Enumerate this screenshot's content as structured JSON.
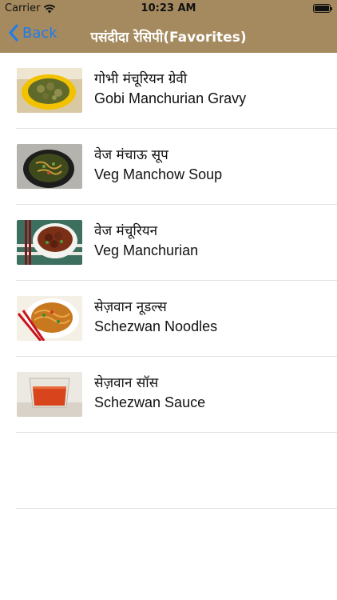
{
  "status_bar": {
    "carrier": "Carrier",
    "time": "10:23 AM",
    "battery_level": 1.0
  },
  "nav": {
    "back_label": "Back",
    "title": "पसंदीदा रेसिपी(Favorites)"
  },
  "recipes": [
    {
      "title_hi": "गोभी मंचूरियन ग्रेवी",
      "title_en": "Gobi Manchurian Gravy"
    },
    {
      "title_hi": "वेज मंचाऊ सूप",
      "title_en": "Veg Manchow Soup"
    },
    {
      "title_hi": "वेज मंचूरियन",
      "title_en": "Veg Manchurian"
    },
    {
      "title_hi": "सेज़वान नूडल्स",
      "title_en": "Schezwan Noodles"
    },
    {
      "title_hi": "सेज़वान सॉस",
      "title_en": "Schezwan Sauce"
    }
  ],
  "colors": {
    "navbar": "#a48a5e",
    "back_tint": "#1e7bf0",
    "title": "#ffffff"
  }
}
